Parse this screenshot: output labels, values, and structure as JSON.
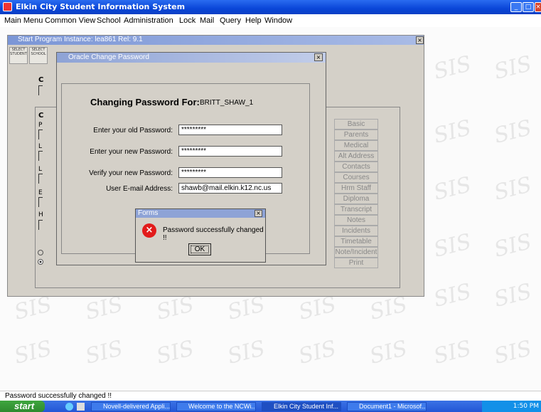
{
  "app": {
    "title": "Elkin City Student Information System"
  },
  "menu": [
    "Main Menu",
    "Common View",
    "School",
    "Administration",
    "Lock",
    "Mail",
    "Query",
    "Help",
    "Window"
  ],
  "watermark": "SIS",
  "start_program": {
    "title": "Start Program  Instance: lea861  Rel: 9.1",
    "tools": [
      "SELECT STUDENT",
      "SELECT SCHOOL"
    ],
    "side_buttons": [
      "Basic",
      "Parents",
      "Medical",
      "Alt Address",
      "Contacts",
      "Courses",
      "Hrm Staff",
      "Diploma",
      "Transcript",
      "Notes",
      "Incidents",
      "Timetable",
      "Note/Incident",
      "Print"
    ],
    "letters": [
      "C",
      "C",
      "P",
      "L",
      "L",
      "E",
      "H"
    ]
  },
  "password_dialog": {
    "title": "Oracle Change Password",
    "heading": "Changing Password For:",
    "username": "BRITT_SHAW_1",
    "old_label": "Enter your old Password:",
    "old_value": "*********",
    "new_label": "Enter your new Password:",
    "new_value": "*********",
    "verify_label": "Verify your new Password:",
    "verify_value": "*********",
    "email_label": "User E-mail Address:",
    "email_value": "shawb@mail.elkin.k12.nc.us"
  },
  "forms_box": {
    "title": "Forms",
    "message": "Password successfully changed !!",
    "ok_label": "OK"
  },
  "status_text": "Password successfully changed !!",
  "taskbar": {
    "start_label": "start",
    "tasks": [
      "Novell-delivered Appli...",
      "Welcome to the NCWi...",
      "Elkin City Student Inf...",
      "Document1 - Microsof..."
    ],
    "clock": "1:50 PM"
  }
}
